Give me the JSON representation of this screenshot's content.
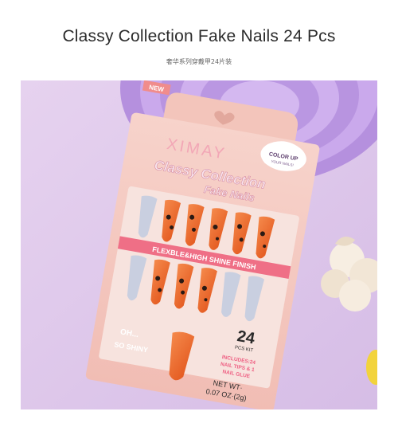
{
  "page": {
    "title": "Classy Collection Fake Nails 24 Pcs",
    "subtitle": "奢华系列穿戴甲24片装"
  },
  "package": {
    "new_badge": "NEW",
    "brand": "XIMAY",
    "color_up_title": "COLOR UP",
    "color_up_sub": "YOUR NAILS!",
    "product_line1": "Classy Collection",
    "product_line2": "Fake Nails",
    "finish_banner": "FLEXBLE&HIGH SHINE FINISH",
    "count_number": "24",
    "count_label": "PCS KIT",
    "includes_line1": "INCLUDES:24",
    "includes_line2": "NAIL TIPS & 1",
    "includes_line3": "NAIL GLUE",
    "oh_text": "OH...",
    "shiny_text": "SO SHINY",
    "net_wt_line1": "NET WT·",
    "net_wt_line2": "0.07 OZ·(2g)"
  },
  "colors": {
    "background_lilac": "#d9c2e6",
    "tray_purple": "#c9a8e8",
    "card_pink": "#f4c7be",
    "nail_orange": "#ee6a2c",
    "nail_grey": "#c9cfe0"
  }
}
